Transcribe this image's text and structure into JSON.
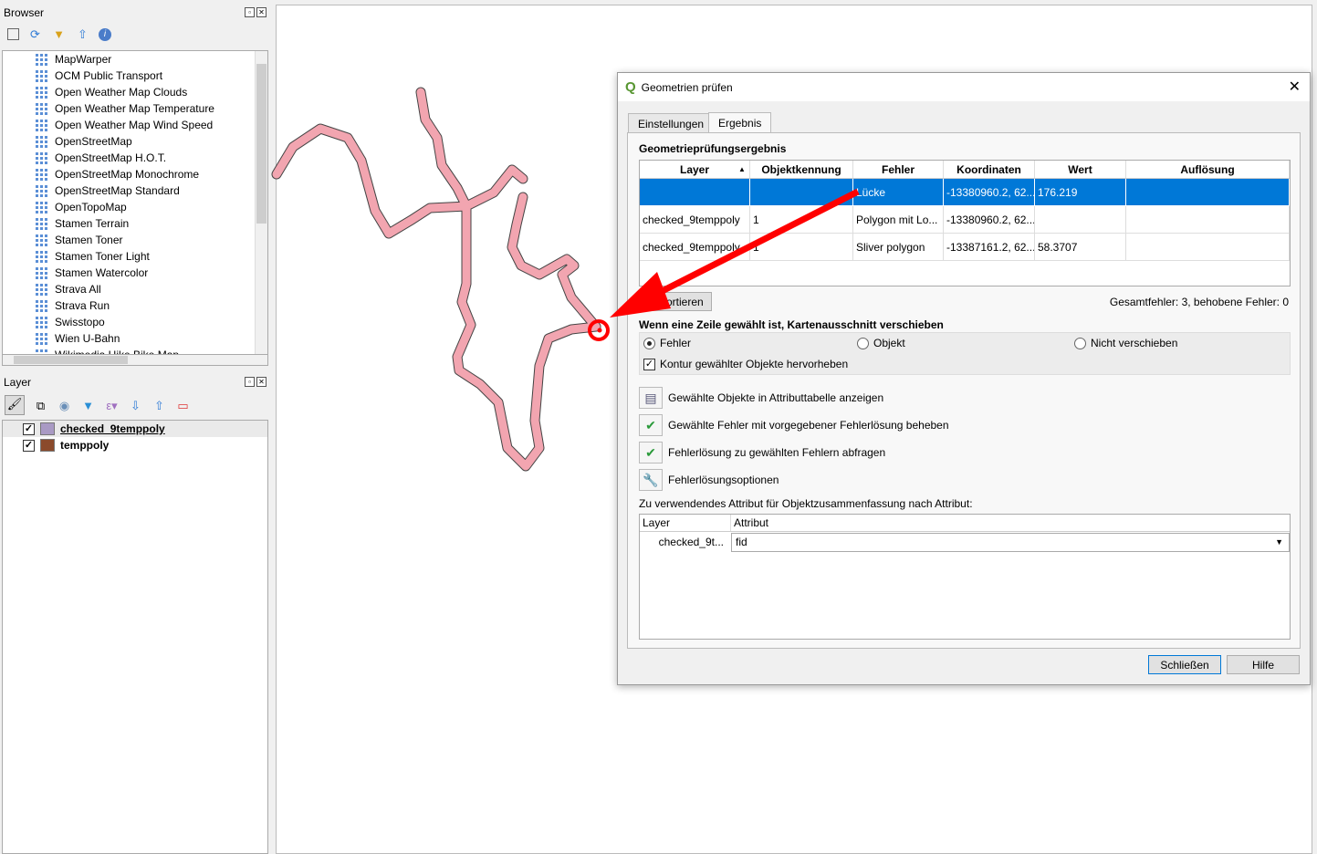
{
  "browser": {
    "title": "Browser",
    "toolbar_icons": [
      "add-layer-icon",
      "refresh-icon",
      "filter-icon",
      "collapse-icon",
      "info-icon"
    ],
    "items": [
      "MapWarper",
      "OCM Public Transport",
      "Open Weather Map Clouds",
      "Open Weather Map Temperature",
      "Open Weather Map Wind Speed",
      "OpenStreetMap",
      "OpenStreetMap H.O.T.",
      "OpenStreetMap Monochrome",
      "OpenStreetMap Standard",
      "OpenTopoMap",
      "Stamen Terrain",
      "Stamen Toner",
      "Stamen Toner Light",
      "Stamen Watercolor",
      "Strava All",
      "Strava Run",
      "Swisstopo",
      "Wien U-Bahn",
      "Wikimedia Hike Bike Map"
    ]
  },
  "layers": {
    "title": "Layer",
    "items": [
      {
        "name": "checked_9temppoly",
        "color": "#a99ac4",
        "checked": true
      },
      {
        "name": "temppoly",
        "color": "#8b4a2b",
        "checked": true
      }
    ]
  },
  "dialog": {
    "title": "Geometrien prüfen",
    "tabs": [
      "Einstellungen",
      "Ergebnis"
    ],
    "active_tab": "Ergebnis",
    "section_title": "Geometrieprüfungsergebnis",
    "columns": [
      "Layer",
      "Objektkennung",
      "Fehler",
      "Koordinaten",
      "Wert",
      "Auflösung"
    ],
    "rows": [
      [
        "",
        "",
        "Lücke",
        "-13380960.2, 62...",
        "176.219",
        ""
      ],
      [
        "checked_9temppoly",
        "1",
        "Polygon mit Lo...",
        "-13380960.2, 62...",
        "",
        ""
      ],
      [
        "checked_9temppoly",
        "1",
        "Sliver polygon",
        "-13387161.2, 62...",
        "58.3707",
        ""
      ]
    ],
    "export_label": "Exportieren",
    "summary": "Gesamtfehler: 3, behobene Fehler: 0",
    "pan_title": "Wenn eine Zeile gewählt ist, Kartenausschnitt verschieben",
    "radios": [
      {
        "label": "Fehler",
        "selected": true
      },
      {
        "label": "Objekt",
        "selected": false
      },
      {
        "label": "Nicht verschieben",
        "selected": false
      }
    ],
    "highlight_label": "Kontur gewählter Objekte hervorheben",
    "actions": [
      "Gewählte Objekte in Attributtabelle anzeigen",
      "Gewählte Fehler mit vorgegebener Fehlerlösung beheben",
      "Fehlerlösung zu gewählten Fehlern abfragen",
      "Fehlerlösungsoptionen"
    ],
    "attr_title": "Zu verwendendes Attribut für Objektzusammenfassung nach Attribut:",
    "attr_columns": [
      "Layer",
      "Attribut"
    ],
    "attr_row": {
      "layer": "checked_9t...",
      "attribute": "fid"
    },
    "close_label": "Schließen",
    "help_label": "Hilfe"
  },
  "colors": {
    "selection": "#0078d7",
    "polygon_fill": "#f2a5b0",
    "annotation": "#ff0000"
  }
}
